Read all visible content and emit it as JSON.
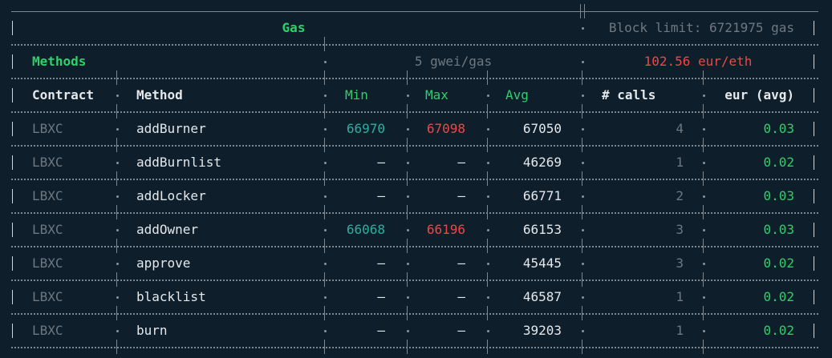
{
  "colors": {
    "background": "#0e1e2b",
    "green": "#2ed06a",
    "teal": "#2bb0a0",
    "red": "#f04646",
    "dim": "#6e7880",
    "text": "#e4e8eb"
  },
  "header": {
    "gas_label": "Gas",
    "block_limit": "Block limit: 6721975 gas",
    "methods_label": "Methods",
    "gas_price": "5 gwei/gas",
    "eth_price": "102.56 eur/eth"
  },
  "columns": {
    "contract": "Contract",
    "method": "Method",
    "min": "Min",
    "max": "Max",
    "avg": "Avg",
    "calls": "# calls",
    "eur_avg": "eur (avg)"
  },
  "rows": [
    {
      "contract": "LBXC",
      "method": "addBurner",
      "min": "66970",
      "max": "67098",
      "avg": "67050",
      "calls": "4",
      "eur": "0.03"
    },
    {
      "contract": "LBXC",
      "method": "addBurnlist",
      "min": "–",
      "max": "–",
      "avg": "46269",
      "calls": "1",
      "eur": "0.02"
    },
    {
      "contract": "LBXC",
      "method": "addLocker",
      "min": "–",
      "max": "–",
      "avg": "66771",
      "calls": "2",
      "eur": "0.03"
    },
    {
      "contract": "LBXC",
      "method": "addOwner",
      "min": "66068",
      "max": "66196",
      "avg": "66153",
      "calls": "3",
      "eur": "0.03"
    },
    {
      "contract": "LBXC",
      "method": "approve",
      "min": "–",
      "max": "–",
      "avg": "45445",
      "calls": "3",
      "eur": "0.02"
    },
    {
      "contract": "LBXC",
      "method": "blacklist",
      "min": "–",
      "max": "–",
      "avg": "46587",
      "calls": "1",
      "eur": "0.02"
    },
    {
      "contract": "LBXC",
      "method": "burn",
      "min": "–",
      "max": "–",
      "avg": "39203",
      "calls": "1",
      "eur": "0.02"
    }
  ]
}
